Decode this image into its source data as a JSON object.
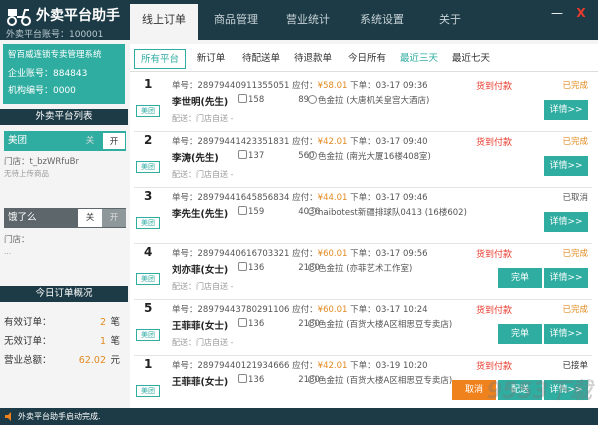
{
  "app": {
    "title": "外卖平台助手",
    "account": "外卖平台账号：100001"
  },
  "nav": {
    "tabs": [
      "线上订单",
      "商品管理",
      "营业统计",
      "系统设置",
      "关于"
    ],
    "minimize": "—",
    "close": "X"
  },
  "merchant": {
    "name": "智百威连锁专卖管理系统",
    "account_line": "企业账号：884843",
    "org_line": "机构编号：0000"
  },
  "sidebar": {
    "platform_list_title": "外卖平台列表",
    "platforms": [
      {
        "name": "美团",
        "off_label": "关",
        "on_label": "开",
        "state": "on",
        "shop": "门店：t_bzWRfuBr",
        "note": "无待上传商品"
      },
      {
        "name": "饿了么",
        "off_label": "关",
        "on_label": "开",
        "state": "off",
        "shop": "门店：",
        "note": "..."
      }
    ],
    "summary_title": "今日订单概况",
    "stats": [
      {
        "label": "有效订单：",
        "value": "2",
        "unit": "笔"
      },
      {
        "label": "无效订单：",
        "value": "1",
        "unit": "笔"
      },
      {
        "label": "营业总额：",
        "value": "62.02",
        "unit": "元"
      }
    ]
  },
  "subtabs": [
    "所有平台",
    "新订单",
    "待配送单",
    "待退款单",
    "今日所有",
    "最近三天",
    "最近七天"
  ],
  "orders": [
    {
      "num": "1",
      "platform": "美团",
      "order_no": "单号：28979440911355051",
      "due_label": "应付：",
      "price": "¥58.01",
      "order_time": "下单：03-17 09:36",
      "pay": "货到付款",
      "status": "已完成",
      "name": "李世明(先生)",
      "phone": "158    89",
      "addr": "色金拉 (大唐机关皇宫大酒店)",
      "deliv": "配送：门店自送 -",
      "buttons": [
        "详情>>"
      ]
    },
    {
      "num": "2",
      "platform": "美团",
      "order_no": "单号：28979441423351831",
      "due_label": "应付：",
      "price": "¥42.01",
      "order_time": "下单：03-17 09:40",
      "pay": "货到付款",
      "status": "已完成",
      "name": "李涛(先生)",
      "phone": "137    560",
      "addr": "色金拉 (南光大厦16楼408室)",
      "deliv": "配送：门店自送 -",
      "buttons": [
        "详情>>"
      ]
    },
    {
      "num": "3",
      "platform": "美团",
      "order_no": "单号：28979441645856834",
      "due_label": "应付：",
      "price": "¥44.01",
      "order_time": "下单：03-17 09:46",
      "pay": "",
      "status": "已取消",
      "name": "李先生(先生)",
      "phone": "159    4036",
      "addr": "haibotest新疆排球队0413 (16楼602)",
      "deliv": "",
      "buttons": [
        "详情>>"
      ]
    },
    {
      "num": "4",
      "platform": "美团",
      "order_no": "单号：28979440616703321",
      "due_label": "应付：",
      "price": "¥60.01",
      "order_time": "下单：03-17 09:56",
      "pay": "货到付款",
      "status": "已完成",
      "name": "刘亦菲(女士)",
      "phone": "136    2180",
      "addr": "色金拉 (亦菲艺术工作室)",
      "deliv": "配送：门店自送 -",
      "buttons": [
        "完单",
        "详情>>"
      ]
    },
    {
      "num": "5",
      "platform": "美团",
      "order_no": "单号：28979443780291106",
      "due_label": "应付：",
      "price": "¥60.01",
      "order_time": "下单：03-17 10:24",
      "pay": "货到付款",
      "status": "已完成",
      "name": "王菲菲(女士)",
      "phone": "136    2180",
      "addr": "色金拉 (百货大楼A区相思豆专卖店)",
      "deliv": "配送：门店自送 -",
      "buttons": [
        "完单",
        "详情>>"
      ]
    },
    {
      "num": "1",
      "platform": "美团",
      "order_no": "单号：28979440121934666",
      "due_label": "应付：",
      "price": "¥42.01",
      "order_time": "下单：03-19 10:20",
      "pay": "货到付款",
      "status": "已接单",
      "name": "王菲菲(女士)",
      "phone": "136    2180",
      "addr": "色金拉 (百货大楼A区相思豆专卖店)",
      "deliv": "",
      "buttons": [
        "取消",
        "配送",
        "详情>>"
      ]
    }
  ],
  "footer": {
    "status": "外卖平台助手启动完成."
  },
  "watermark": "9553下载",
  "colors": {
    "header_bg": "#1d3b46",
    "accent": "#2fada0",
    "price": "#e28b21",
    "pay_red": "#e83b2e",
    "cancel_orange": "#f0821e"
  }
}
